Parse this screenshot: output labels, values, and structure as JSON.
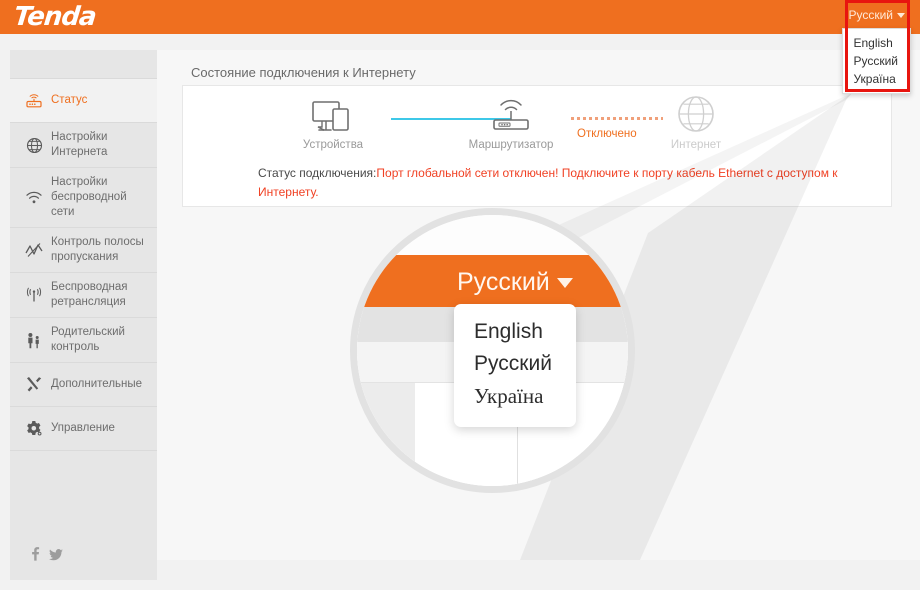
{
  "brand": "Tenda",
  "language": {
    "current": "Русский",
    "options": [
      "English",
      "Русский",
      "Україна"
    ]
  },
  "sidebar": {
    "items": [
      {
        "label": "Статус",
        "icon": "router-status-icon",
        "active": true
      },
      {
        "label": "Настройки Интернета",
        "icon": "globe-icon",
        "active": false
      },
      {
        "label": "Настройки беспроводной сети",
        "icon": "wifi-icon",
        "active": false
      },
      {
        "label": "Контроль полосы пропускания",
        "icon": "bandwidth-chart-icon",
        "active": false
      },
      {
        "label": "Беспроводная ретрансляция",
        "icon": "antenna-icon",
        "active": false
      },
      {
        "label": "Родительский контроль",
        "icon": "parental-icon",
        "active": false
      },
      {
        "label": "Дополнительные",
        "icon": "tools-icon",
        "active": false
      },
      {
        "label": "Управление",
        "icon": "gear-icon",
        "active": false
      }
    ],
    "social": [
      {
        "name": "facebook-icon",
        "glyph": "f"
      },
      {
        "name": "twitter-icon",
        "glyph": "🐦"
      }
    ]
  },
  "main": {
    "page_title": "Состояние подключения к Интернету",
    "topology": {
      "devices_label": "Устройства",
      "router_label": "Маршрутизатор",
      "internet_label": "Интернет",
      "wan_state": "Отключено"
    },
    "status": {
      "prefix": "Статус подключения:",
      "message": "Порт глобальной сети отключен! Подключите к порту кабель Ethernet с доступом к Интернету."
    }
  },
  "magnifier": {
    "label": "Русский",
    "options": [
      "English",
      "Русский",
      "Україна"
    ]
  },
  "colors": {
    "brand_orange": "#ef6f1f",
    "warning_red": "#f04124",
    "link_cyan": "#3ec8e8",
    "highlight_box": "#e8150f"
  }
}
